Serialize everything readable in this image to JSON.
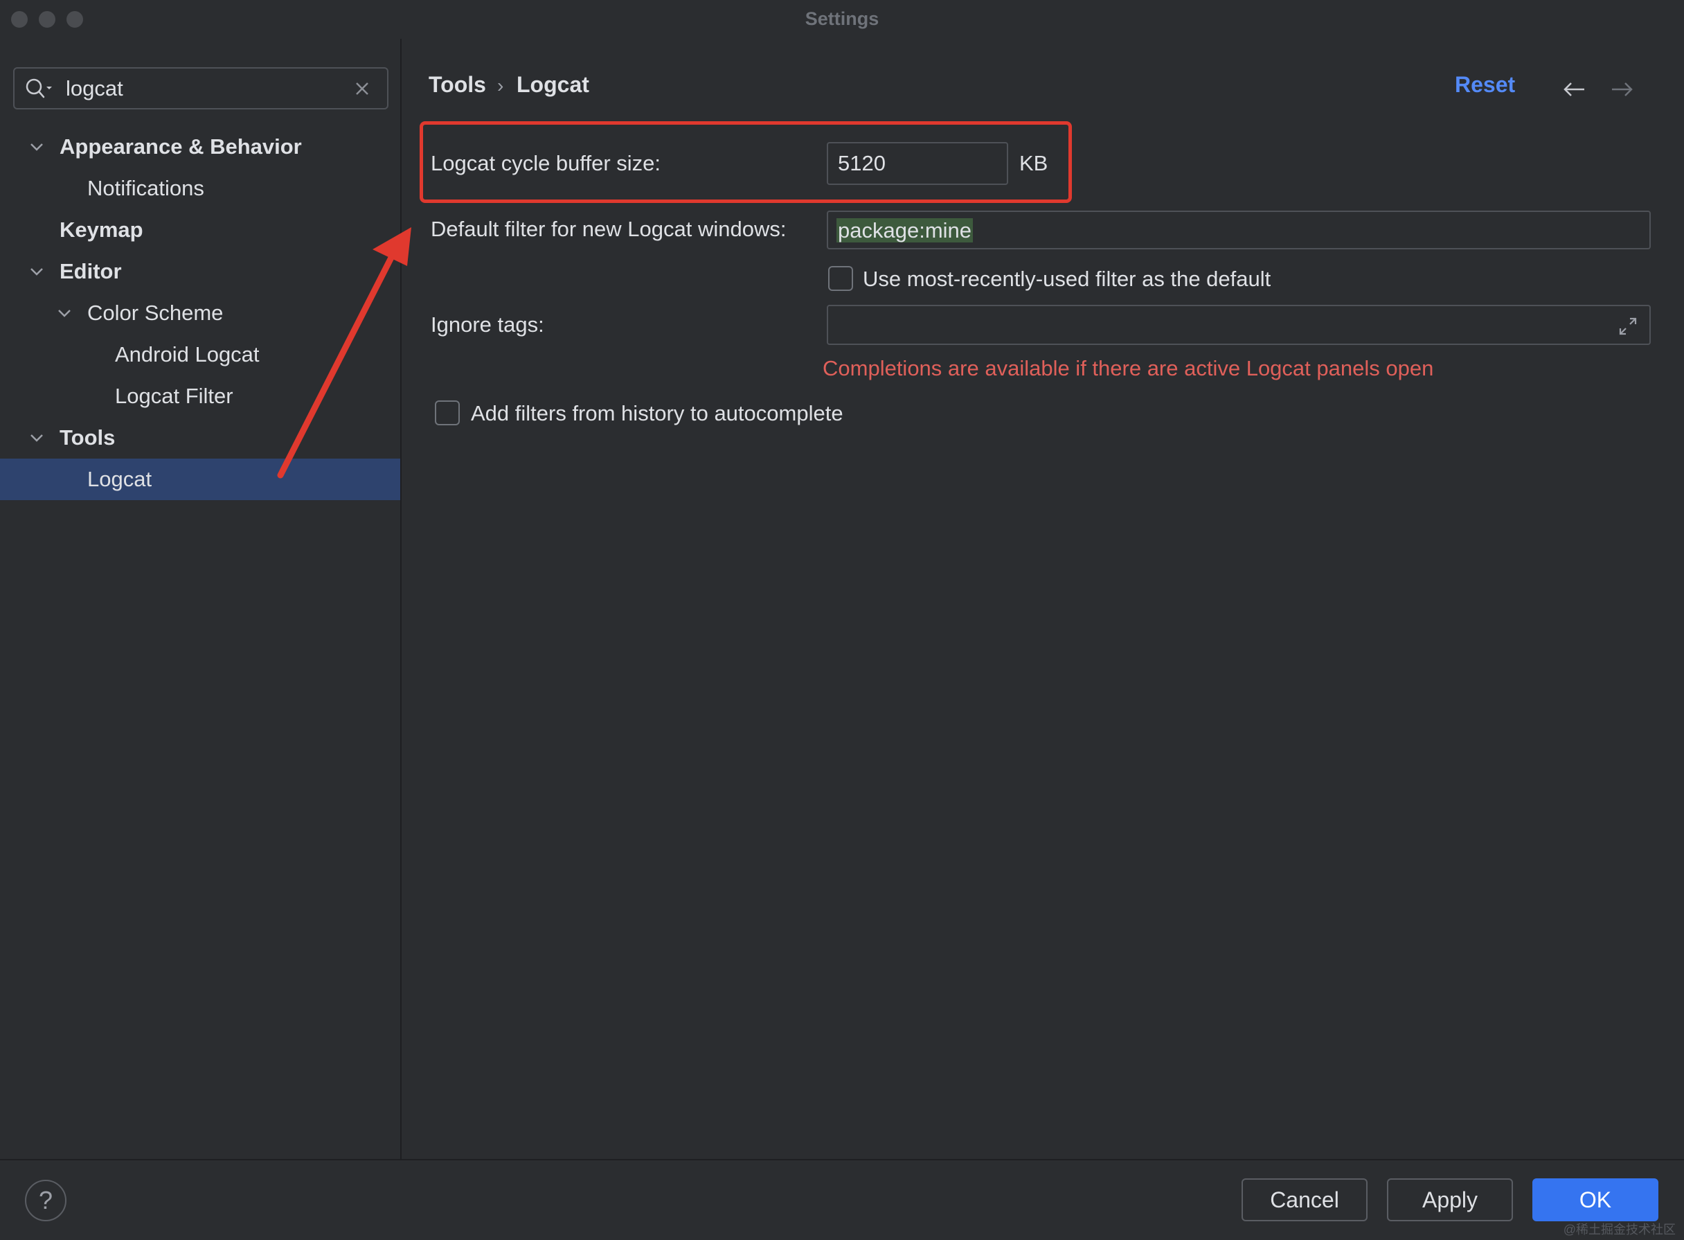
{
  "window": {
    "title": "Settings"
  },
  "search": {
    "value": "logcat"
  },
  "tree": {
    "items": [
      {
        "label": "Appearance & Behavior"
      },
      {
        "label": "Notifications"
      },
      {
        "label": "Keymap"
      },
      {
        "label": "Editor"
      },
      {
        "label": "Color Scheme"
      },
      {
        "label": "Android Logcat"
      },
      {
        "label": "Logcat Filter"
      },
      {
        "label": "Tools"
      },
      {
        "label": "Logcat"
      }
    ],
    "selected": "Logcat"
  },
  "breadcrumb": {
    "parent": "Tools",
    "separator": "›",
    "current": "Logcat"
  },
  "header": {
    "reset_label": "Reset"
  },
  "settings": {
    "buffer_label": "Logcat cycle buffer size:",
    "buffer_value": "5120",
    "buffer_unit": "KB",
    "default_filter_label": "Default filter for new Logcat windows:",
    "default_filter_value": "package:mine",
    "mru_checkbox_label": "Use most-recently-used filter as the default",
    "mru_checked": false,
    "ignore_tags_label": "Ignore tags:",
    "ignore_tags_value": "",
    "completions_hint": "Completions are available if there are active Logcat panels open",
    "history_checkbox_label": "Add filters from history to autocomplete",
    "history_checked": false
  },
  "footer": {
    "help_label": "?",
    "cancel_label": "Cancel",
    "apply_label": "Apply",
    "ok_label": "OK",
    "watermark": "@稀土掘金技术社区"
  },
  "colors": {
    "background": "#2b2d30",
    "selection": "#2e436e",
    "accent": "#548af7",
    "primary_button": "#3574f0",
    "annotation_red": "#e0392e",
    "hint_red": "#e0605a"
  },
  "icons": {
    "search": "search-icon",
    "clear": "clear-icon",
    "chevron": "chevron-down-icon",
    "back": "back-arrow-icon",
    "forward": "forward-arrow-icon",
    "expand": "expand-icon"
  }
}
